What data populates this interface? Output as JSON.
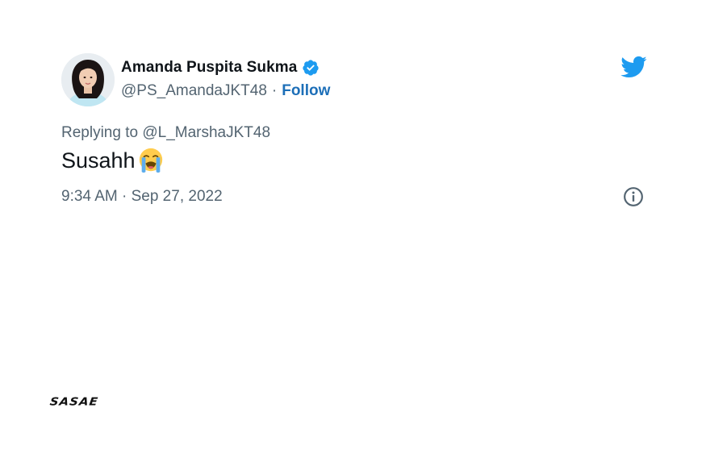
{
  "tweet": {
    "display_name": "Amanda Puspita Sukma",
    "handle": "@PS_AmandaJKT48",
    "separator": "·",
    "follow_label": "Follow",
    "replying_prefix": "Replying to ",
    "replying_to": "@L_MarshaJKT48",
    "text": "Susahh",
    "emoji": "loudly-crying-face",
    "timestamp": "9:34 AM · Sep 27, 2022"
  },
  "icons": {
    "verified": "verified-badge-icon",
    "twitter": "twitter-bird-icon",
    "info": "info-icon"
  },
  "colors": {
    "accent": "#1d9bf0",
    "follow": "#1d6fb8",
    "secondary_text": "#536471",
    "primary_text": "#0f1419"
  },
  "brand": {
    "logo_text": "SASAE"
  }
}
